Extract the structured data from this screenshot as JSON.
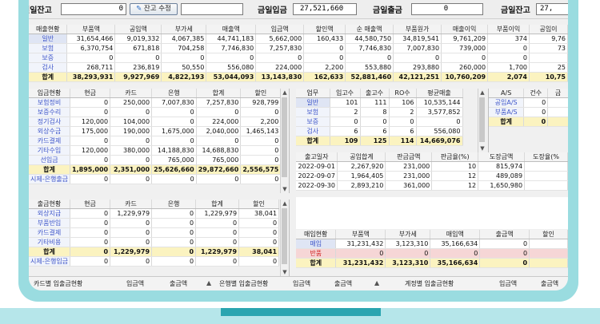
{
  "topbar": {
    "prev_balance_label": "전일잔고",
    "prev_balance_value": "0",
    "balance_edit_button": "잔고 수정",
    "today_deposit_label": "금일입금",
    "today_deposit_value": "27,521,660",
    "today_withdraw_label": "금일출금",
    "today_withdraw_value": "0",
    "today_balance_label": "금일잔고",
    "today_balance_value": "27,"
  },
  "sales": {
    "headers": [
      "매출현황",
      "부품액",
      "공임액",
      "부가세",
      "매출액",
      "입금액",
      "할인액",
      "순 매출액",
      "부품원가",
      "매출이익",
      "부품이익",
      "공임이"
    ],
    "rows": [
      [
        "일반",
        "31,654,466",
        "9,019,332",
        "4,067,385",
        "44,741,183",
        "5,662,000",
        "160,433",
        "44,580,750",
        "34,819,541",
        "9,761,209",
        "374",
        "9,76"
      ],
      [
        "보험",
        "6,370,754",
        "671,818",
        "704,258",
        "7,746,830",
        "7,257,830",
        "0",
        "7,746,830",
        "7,007,830",
        "739,000",
        "0",
        "73"
      ],
      [
        "보증",
        "0",
        "0",
        "0",
        "0",
        "0",
        "0",
        "0",
        "0",
        "0",
        "0",
        ""
      ],
      [
        "검사",
        "268,711",
        "236,819",
        "50,550",
        "556,080",
        "224,000",
        "2,200",
        "553,880",
        "293,880",
        "260,000",
        "1,700",
        "25"
      ],
      [
        "합계",
        "38,293,931",
        "9,927,969",
        "4,822,193",
        "53,044,093",
        "13,143,830",
        "162,633",
        "52,881,460",
        "42,121,251",
        "10,760,209",
        "2,074",
        "10,75"
      ]
    ]
  },
  "deposit": {
    "headers": [
      "입금현황",
      "현금",
      "카드",
      "은행",
      "합계",
      "할인"
    ],
    "rows": [
      [
        "보험정비",
        "0",
        "250,000",
        "7,007,830",
        "7,257,830",
        "928,799"
      ],
      [
        "보증수리",
        "0",
        "0",
        "0",
        "0",
        "0"
      ],
      [
        "정기검사",
        "120,000",
        "104,000",
        "0",
        "224,000",
        "2,200"
      ],
      [
        "외상수금",
        "175,000",
        "190,000",
        "1,675,000",
        "2,040,000",
        "1,465,143"
      ],
      [
        "카드결제",
        "0",
        "0",
        "0",
        "0",
        "0"
      ],
      [
        "기타수입",
        "120,000",
        "380,000",
        "14,188,830",
        "14,688,830",
        "0"
      ],
      [
        "선입금",
        "0",
        "0",
        "765,000",
        "765,000",
        "0"
      ],
      [
        "합계",
        "1,895,000",
        "2,351,000",
        "25,626,660",
        "29,872,660",
        "2,556,575"
      ],
      [
        "시제-은행출금",
        "0",
        "0",
        "0",
        "0",
        "0"
      ]
    ]
  },
  "business": {
    "headers": [
      "업무",
      "입고수",
      "출고수",
      "RO수",
      "평균매출"
    ],
    "rows": [
      [
        "일반",
        "101",
        "111",
        "106",
        "10,535,144"
      ],
      [
        "보험",
        "2",
        "8",
        "2",
        "3,577,852"
      ],
      [
        "보증",
        "0",
        "0",
        "0",
        "0"
      ],
      [
        "검사",
        "6",
        "6",
        "6",
        "556,080"
      ],
      [
        "합계",
        "109",
        "125",
        "114",
        "14,669,076"
      ]
    ]
  },
  "as": {
    "headers": [
      "A/S",
      "건수",
      "금"
    ],
    "rows": [
      [
        "공임A/S",
        "0",
        ""
      ],
      [
        "부품A/S",
        "0",
        ""
      ],
      [
        "합계",
        "0",
        ""
      ]
    ]
  },
  "release": {
    "headers": [
      "출고일자",
      "공임합계",
      "판금금액",
      "판금율(%)",
      "도장금액",
      "도장율(%"
    ],
    "rows": [
      [
        "2022-09-01",
        "2,267,920",
        "231,000",
        "10",
        "815,974",
        ""
      ],
      [
        "2022-09-07",
        "1,964,405",
        "231,000",
        "12",
        "489,089",
        ""
      ],
      [
        "2022-09-30",
        "2,893,210",
        "361,000",
        "12",
        "1,650,980",
        ""
      ]
    ]
  },
  "withdraw": {
    "headers": [
      "출금현황",
      "현금",
      "카드",
      "은행",
      "합계",
      "할인"
    ],
    "rows": [
      [
        "외상지급",
        "0",
        "1,229,979",
        "0",
        "1,229,979",
        "38,041"
      ],
      [
        "부품반입",
        "0",
        "0",
        "0",
        "0",
        "0"
      ],
      [
        "카드결제",
        "0",
        "0",
        "0",
        "0",
        "0"
      ],
      [
        "기타비용",
        "0",
        "0",
        "0",
        "0",
        "0"
      ],
      [
        "합계",
        "0",
        "1,229,979",
        "0",
        "1,229,979",
        "38,041"
      ],
      [
        "시제-은행입금",
        "0",
        "0",
        "0",
        "0",
        "0"
      ]
    ]
  },
  "purchase": {
    "headers": [
      "매입현황",
      "부품액",
      "부가세",
      "매입액",
      "출금액",
      "할인"
    ],
    "rows": [
      [
        "매입",
        "31,231,432",
        "3,123,310",
        "35,166,634",
        "0",
        ""
      ],
      [
        "반품",
        "0",
        "0",
        "0",
        "0",
        ""
      ],
      [
        "합계",
        "31,231,432",
        "3,123,310",
        "35,166,634",
        "0",
        ""
      ]
    ]
  },
  "bottom": {
    "card_status": "카드별 입출금현황",
    "deposit_amount": "입금액",
    "withdraw_amount": "출금액",
    "bank_status": "은행별 입출금현황",
    "deposit_amount2": "입금액",
    "withdraw_amount2": "출금액",
    "account_status": "계정별 입출금현황",
    "deposit_amount3": "입금액",
    "withdraw_amount3": "출금액"
  },
  "colors": {
    "bezel": "#9adce0",
    "accent_bar": "#2ba5b0",
    "total_row": "#fbf3c0",
    "return_row": "#f6d6d6"
  }
}
